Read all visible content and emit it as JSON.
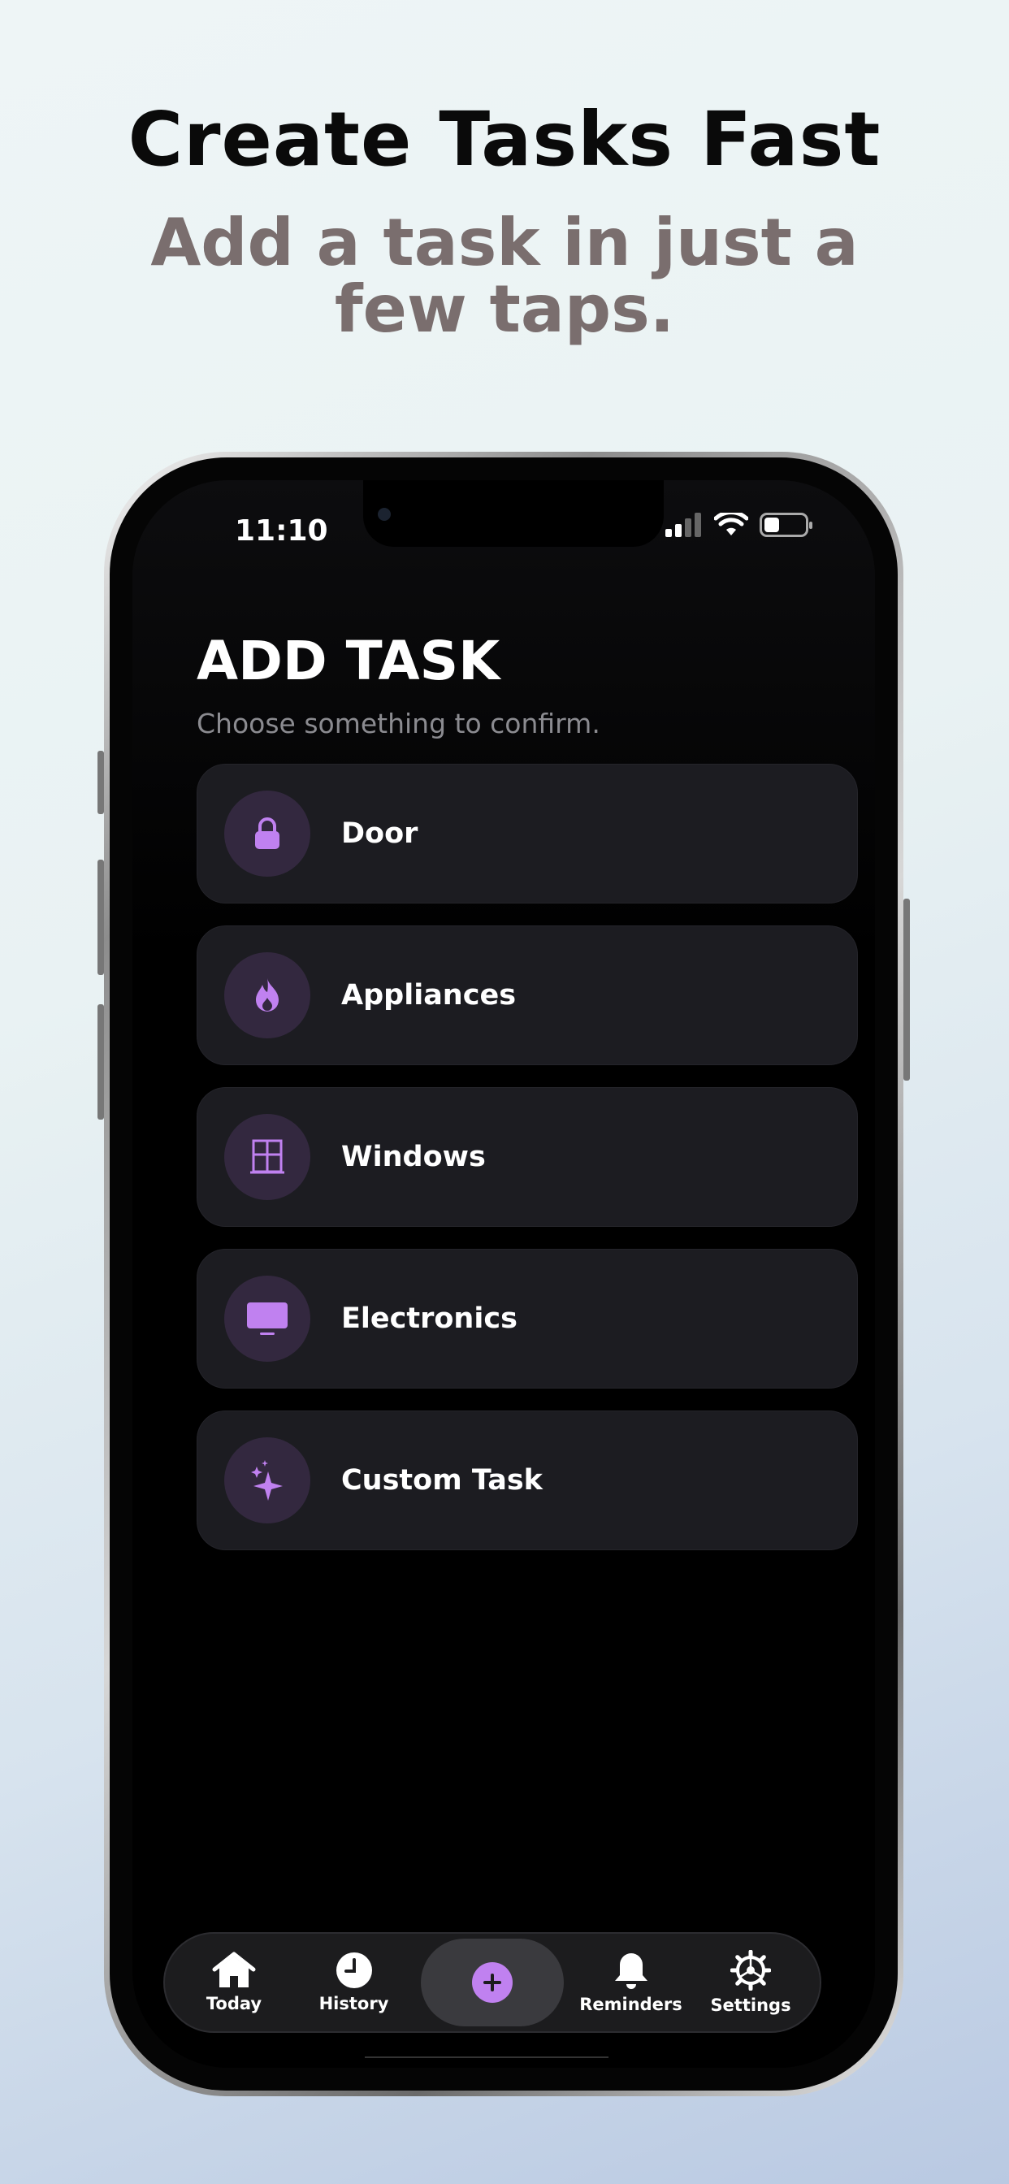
{
  "hero": {
    "title": "Create Tasks Fast",
    "subtitle": "Add a task in just a few taps."
  },
  "status_bar": {
    "time": "11:10"
  },
  "screen": {
    "title": "ADD TASK",
    "subtitle": "Choose something to confirm."
  },
  "tasks": [
    {
      "label": "Door",
      "icon": "lock-icon"
    },
    {
      "label": "Appliances",
      "icon": "flame-icon"
    },
    {
      "label": "Windows",
      "icon": "window-icon"
    },
    {
      "label": "Electronics",
      "icon": "tv-icon"
    },
    {
      "label": "Custom Task",
      "icon": "sparkles-icon"
    }
  ],
  "tabbar": {
    "today": "Today",
    "history": "History",
    "reminders": "Reminders",
    "settings": "Settings"
  },
  "colors": {
    "accent": "#c081f0",
    "card": "#1c1c21",
    "icon_bg": "#33283f"
  }
}
